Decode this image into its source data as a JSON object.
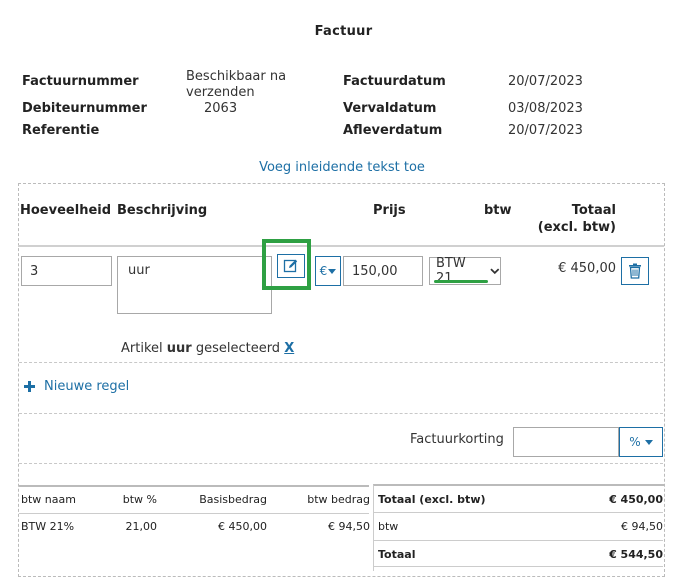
{
  "title": "Factuur",
  "meta": {
    "factuurnummer_label": "Factuurnummer",
    "factuurnummer_value_line1": "Beschikbaar na",
    "factuurnummer_value_line2": "verzenden",
    "debiteurnummer_label": "Debiteurnummer",
    "debiteurnummer_value": "2063",
    "referentie_label": "Referentie",
    "factuurdatum_label": "Factuurdatum",
    "factuurdatum_value": "20/07/2023",
    "vervaldatum_label": "Vervaldatum",
    "vervaldatum_value": "03/08/2023",
    "afleverdatum_label": "Afleverdatum",
    "afleverdatum_value": "20/07/2023"
  },
  "intro_link": "Voeg inleidende tekst toe",
  "table_header": {
    "hoeveelheid": "Hoeveelheid",
    "beschrijving": "Beschrijving",
    "prijs": "Prijs",
    "btw": "btw",
    "totaal_line1": "Totaal",
    "totaal_line2": "(excl. btw)"
  },
  "line": {
    "quantity": "3",
    "description": "uur",
    "currency": "€",
    "price": "150,00",
    "vat": "BTW 21",
    "total": "€ 450,00"
  },
  "article_selected": {
    "prefix": "Artikel ",
    "name": "uur",
    "suffix": " geselecteerd ",
    "clear": "X"
  },
  "new_line": "Nieuwe regel",
  "discount": {
    "label": "Factuurkorting",
    "value": "",
    "unit": "%"
  },
  "vat_summary": {
    "headers": [
      "btw naam",
      "btw %",
      "Basisbedrag",
      "btw bedrag"
    ],
    "rows": [
      {
        "name": "BTW 21%",
        "percent": "21,00",
        "base": "€ 450,00",
        "amount": "€ 94,50"
      }
    ]
  },
  "totals": {
    "excl_label": "Totaal (excl. btw)",
    "excl_value": "€ 450,00",
    "btw_label": "btw",
    "btw_value": "€ 94,50",
    "total_label": "Totaal",
    "total_value": "€ 544,50"
  },
  "colors": {
    "accent": "#1d6fa5",
    "highlight": "#2ea043"
  }
}
